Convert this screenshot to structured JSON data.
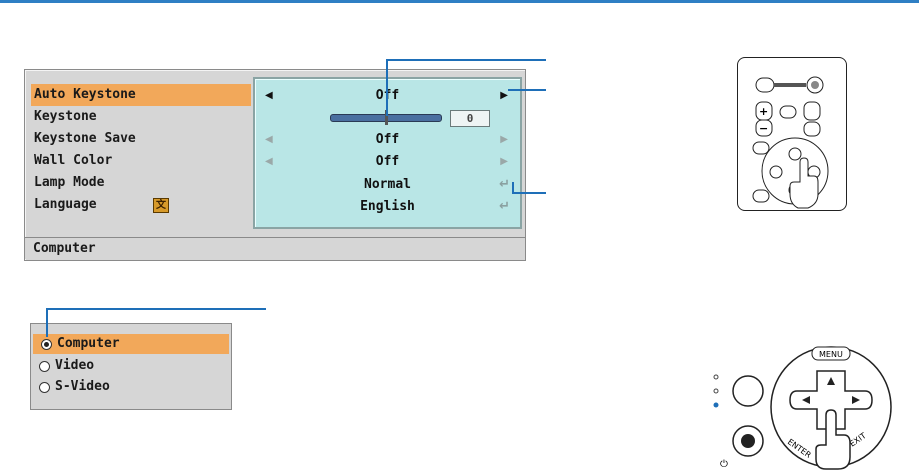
{
  "osd_menu": {
    "items": [
      {
        "label": "Auto Keystone",
        "value": "Off",
        "selected": true
      },
      {
        "label": "Keystone",
        "value": "0",
        "selected": false
      },
      {
        "label": "Keystone Save",
        "value": "Off",
        "selected": false
      },
      {
        "label": "Wall Color",
        "value": "Off",
        "selected": false
      },
      {
        "label": "Lamp Mode",
        "value": "Normal",
        "selected": false
      },
      {
        "label": "Language",
        "value": "English",
        "selected": false
      }
    ],
    "status": "Computer"
  },
  "source_menu": {
    "items": [
      {
        "label": "Computer",
        "selected": true
      },
      {
        "label": "Video",
        "selected": false
      },
      {
        "label": "S-Video",
        "selected": false
      }
    ]
  },
  "control_panel": {
    "menu_label": "MENU",
    "enter_label": "ENTER",
    "exit_label": "EXIT"
  },
  "colors": {
    "accent_blue": "#2f7fc4",
    "callout_blue": "#1e6fb8",
    "highlight_orange": "#f2a85a",
    "value_panel_cyan": "#b9e6e6",
    "menu_gray": "#d6d6d6"
  }
}
